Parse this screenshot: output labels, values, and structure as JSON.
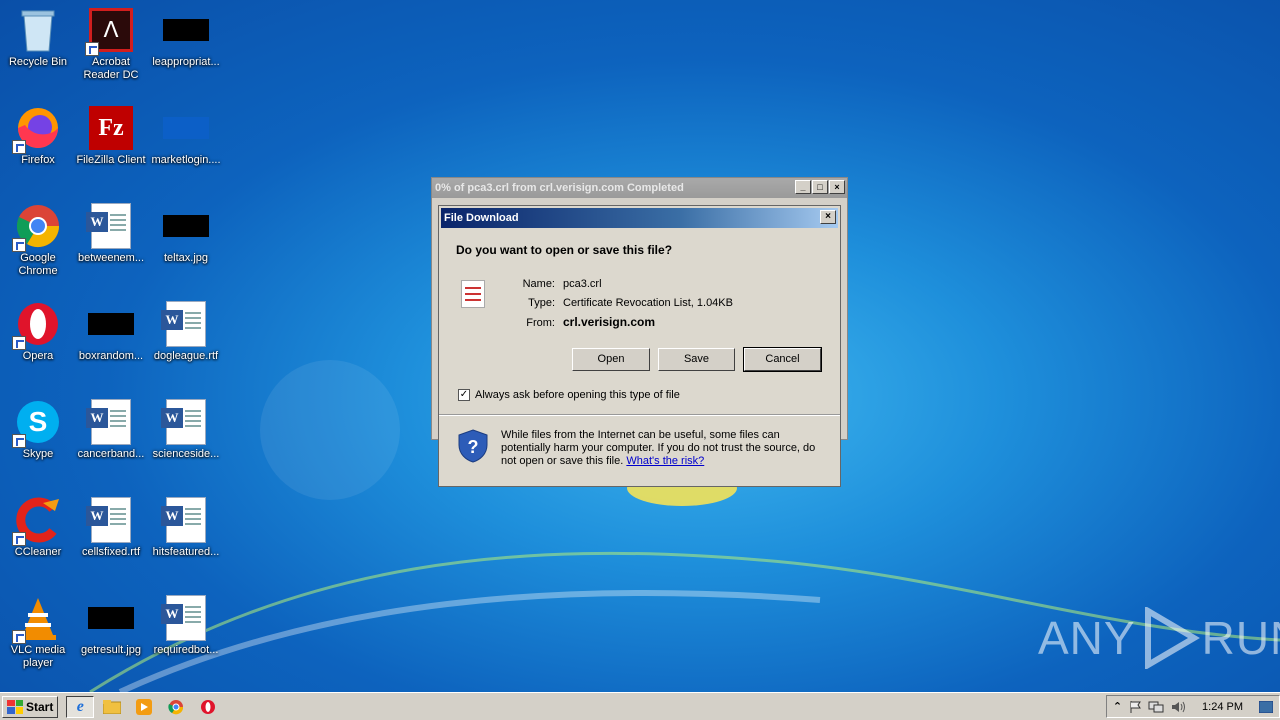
{
  "desktop_icons": [
    {
      "label": "Recycle Bin",
      "icon": "recycle-bin-icon"
    },
    {
      "label": "Acrobat Reader DC",
      "icon": "acrobat-icon"
    },
    {
      "label": "leappropriat...",
      "icon": "image-file-icon"
    },
    {
      "label": "Firefox",
      "icon": "firefox-icon"
    },
    {
      "label": "FileZilla Client",
      "icon": "filezilla-icon"
    },
    {
      "label": "marketlogin....",
      "icon": "file-icon"
    },
    {
      "label": "Google Chrome",
      "icon": "chrome-icon"
    },
    {
      "label": "betweenem...",
      "icon": "word-doc-icon"
    },
    {
      "label": "teltax.jpg",
      "icon": "image-file-icon"
    },
    {
      "label": "Opera",
      "icon": "opera-icon"
    },
    {
      "label": "boxrandom...",
      "icon": "image-file-icon"
    },
    {
      "label": "dogleague.rtf",
      "icon": "word-doc-icon"
    },
    {
      "label": "Skype",
      "icon": "skype-icon"
    },
    {
      "label": "cancerband...",
      "icon": "word-doc-icon"
    },
    {
      "label": "scienceside...",
      "icon": "word-doc-icon"
    },
    {
      "label": "CCleaner",
      "icon": "ccleaner-icon"
    },
    {
      "label": "cellsfixed.rtf",
      "icon": "word-doc-icon"
    },
    {
      "label": "hitsfeatured...",
      "icon": "word-doc-icon"
    },
    {
      "label": "VLC media player",
      "icon": "vlc-icon"
    },
    {
      "label": "getresult.jpg",
      "icon": "image-file-icon"
    },
    {
      "label": "requiredbot...",
      "icon": "word-doc-icon"
    }
  ],
  "progress_window": {
    "title": "0% of pca3.crl from crl.verisign.com Completed",
    "min": "_",
    "max": "□",
    "close": "×"
  },
  "dialog": {
    "title": "File Download",
    "close": "×",
    "question": "Do you want to open or save this file?",
    "name_label": "Name:",
    "name_value": "pca3.crl",
    "type_label": "Type:",
    "type_value": "Certificate Revocation List, 1.04KB",
    "from_label": "From:",
    "from_value": "crl.verisign.com",
    "open_button": "Open",
    "save_button": "Save",
    "cancel_button": "Cancel",
    "checkbox_label": "Always ask before opening this type of file",
    "checkbox_checked": true,
    "checkbox_mark": "✓",
    "warning_text": "While files from the Internet can be useful, some files can potentially harm your computer. If you do not trust the source, do not open or save this file.",
    "warning_link": "What's the risk?"
  },
  "taskbar": {
    "start_label": "Start",
    "clock": "1:24 PM",
    "tray_expand": "⌃"
  },
  "watermark": {
    "left": "ANY",
    "right": "RUN"
  }
}
